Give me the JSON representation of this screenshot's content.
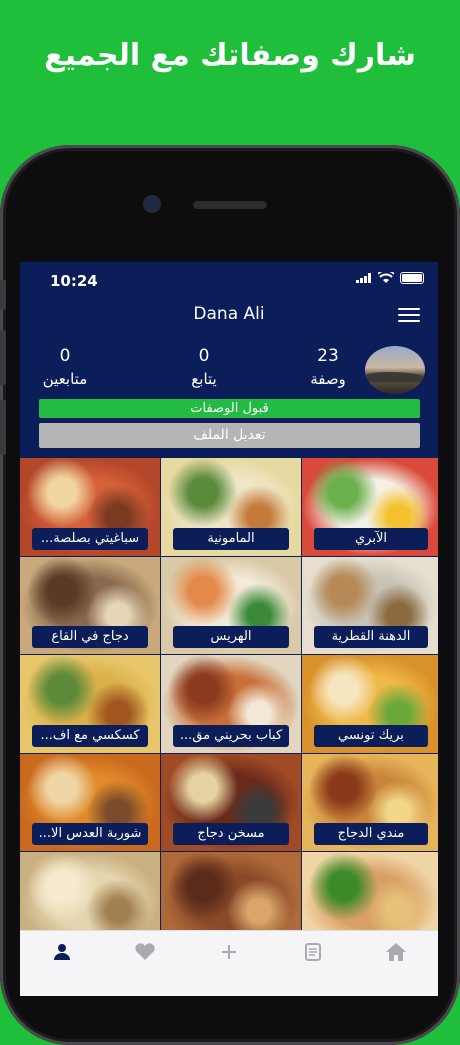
{
  "banner": {
    "title": "شارك  وصفاتك مع الجميع"
  },
  "status_bar": {
    "time": "10:24"
  },
  "profile": {
    "name": "Dana Ali",
    "stats": [
      {
        "key": "recipes",
        "value": "23",
        "label": "وصفة"
      },
      {
        "key": "following",
        "value": "0",
        "label": "يتابع"
      },
      {
        "key": "followers",
        "value": "0",
        "label": "متابعين"
      }
    ],
    "accept_button": "قبول الوصفات",
    "edit_button": "تعدبل الملف"
  },
  "recipes": [
    {
      "label": "الآبري",
      "colors": [
        "#f5f0e6",
        "#d94a3a",
        "#6ab04c",
        "#f4c230"
      ]
    },
    {
      "label": "المامونية",
      "colors": [
        "#efe6c8",
        "#e8d9a0",
        "#5a8a3a",
        "#c47a3a"
      ]
    },
    {
      "label": "سباغيتي بصلصة...",
      "colors": [
        "#d6603a",
        "#b4472a",
        "#f0d6a0",
        "#7a3a20"
      ]
    },
    {
      "label": "الدهنة القطرية",
      "colors": [
        "#c8c2b6",
        "#e6dfcf",
        "#b58a56",
        "#8a6a3e"
      ]
    },
    {
      "label": "الهريس",
      "colors": [
        "#f3ead8",
        "#d9c9a6",
        "#e38a4a",
        "#3a8a3a"
      ]
    },
    {
      "label": "دجاج في القاع",
      "colors": [
        "#8a6a4e",
        "#c9a97c",
        "#5a3a26",
        "#e6d6b6"
      ]
    },
    {
      "label": "بريك تونسي",
      "colors": [
        "#f0b848",
        "#d9922a",
        "#f6e6c0",
        "#6aa83a"
      ]
    },
    {
      "label": "كباب بحريني مق...",
      "colors": [
        "#c9703a",
        "#e2d6c0",
        "#8a3a1e",
        "#f2ead8"
      ]
    },
    {
      "label": "كسكسي مع اف...",
      "colors": [
        "#d9b04a",
        "#e8c66a",
        "#5a8a3a",
        "#a0561e"
      ]
    },
    {
      "label": "مندي الدجاج",
      "colors": [
        "#c9863a",
        "#e6b45a",
        "#8a3a1a",
        "#f2d68a"
      ]
    },
    {
      "label": "مسخن دجاج",
      "colors": [
        "#6a2a1a",
        "#a04a26",
        "#e6d2a0",
        "#3a3a3a"
      ]
    },
    {
      "label": "شوربة العدس الا...",
      "colors": [
        "#e08a2a",
        "#c96a1e",
        "#f0d6a6",
        "#7a4a2a"
      ]
    },
    {
      "label": "",
      "colors": [
        "#d9a066",
        "#f0d6a6",
        "#3a8a2a",
        "#e6c27a"
      ]
    },
    {
      "label": "",
      "colors": [
        "#8a4a2a",
        "#b06a3a",
        "#5a2a1a",
        "#d9a66a"
      ]
    },
    {
      "label": "",
      "colors": [
        "#e6d6b0",
        "#c9b080",
        "#f6ead0",
        "#a08050"
      ]
    }
  ],
  "tabbar": {
    "items": [
      {
        "key": "profile",
        "icon": "person-icon",
        "active": true
      },
      {
        "key": "favorites",
        "icon": "heart-icon",
        "active": false
      },
      {
        "key": "add",
        "icon": "plus-icon",
        "active": false
      },
      {
        "key": "recipes",
        "icon": "book-icon",
        "active": false
      },
      {
        "key": "home",
        "icon": "home-icon",
        "active": false
      }
    ]
  },
  "colors": {
    "background": "#1fbf3c",
    "screen": "#0c1e5a",
    "accept": "#22bb44",
    "edit": "#b5b5b5"
  }
}
